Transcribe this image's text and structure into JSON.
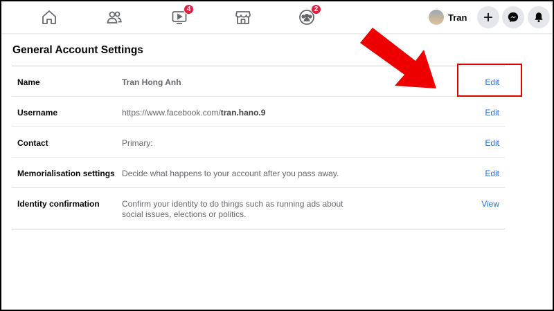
{
  "nav": {
    "watch_badge": "4",
    "groups_badge": "2",
    "profile_name": "Tran"
  },
  "page": {
    "title": "General Account Settings"
  },
  "rows": [
    {
      "label": "Name",
      "value": "Tran Hong Anh",
      "action": "Edit"
    },
    {
      "label": "Username",
      "value_prefix": "https://www.facebook.com/",
      "value_bold": "tran.hano.9",
      "action": "Edit"
    },
    {
      "label": "Contact",
      "value": "Primary:",
      "action": "Edit"
    },
    {
      "label": "Memorialisation settings",
      "value": "Decide what happens to your account after you pass away.",
      "action": "Edit"
    },
    {
      "label": "Identity confirmation",
      "value": "Confirm your identity to do things such as running ads about social issues, elections or politics.",
      "action": "View"
    }
  ],
  "colors": {
    "link": "#216fdb",
    "badge": "#e41e3f",
    "annotation": "#e00000"
  }
}
